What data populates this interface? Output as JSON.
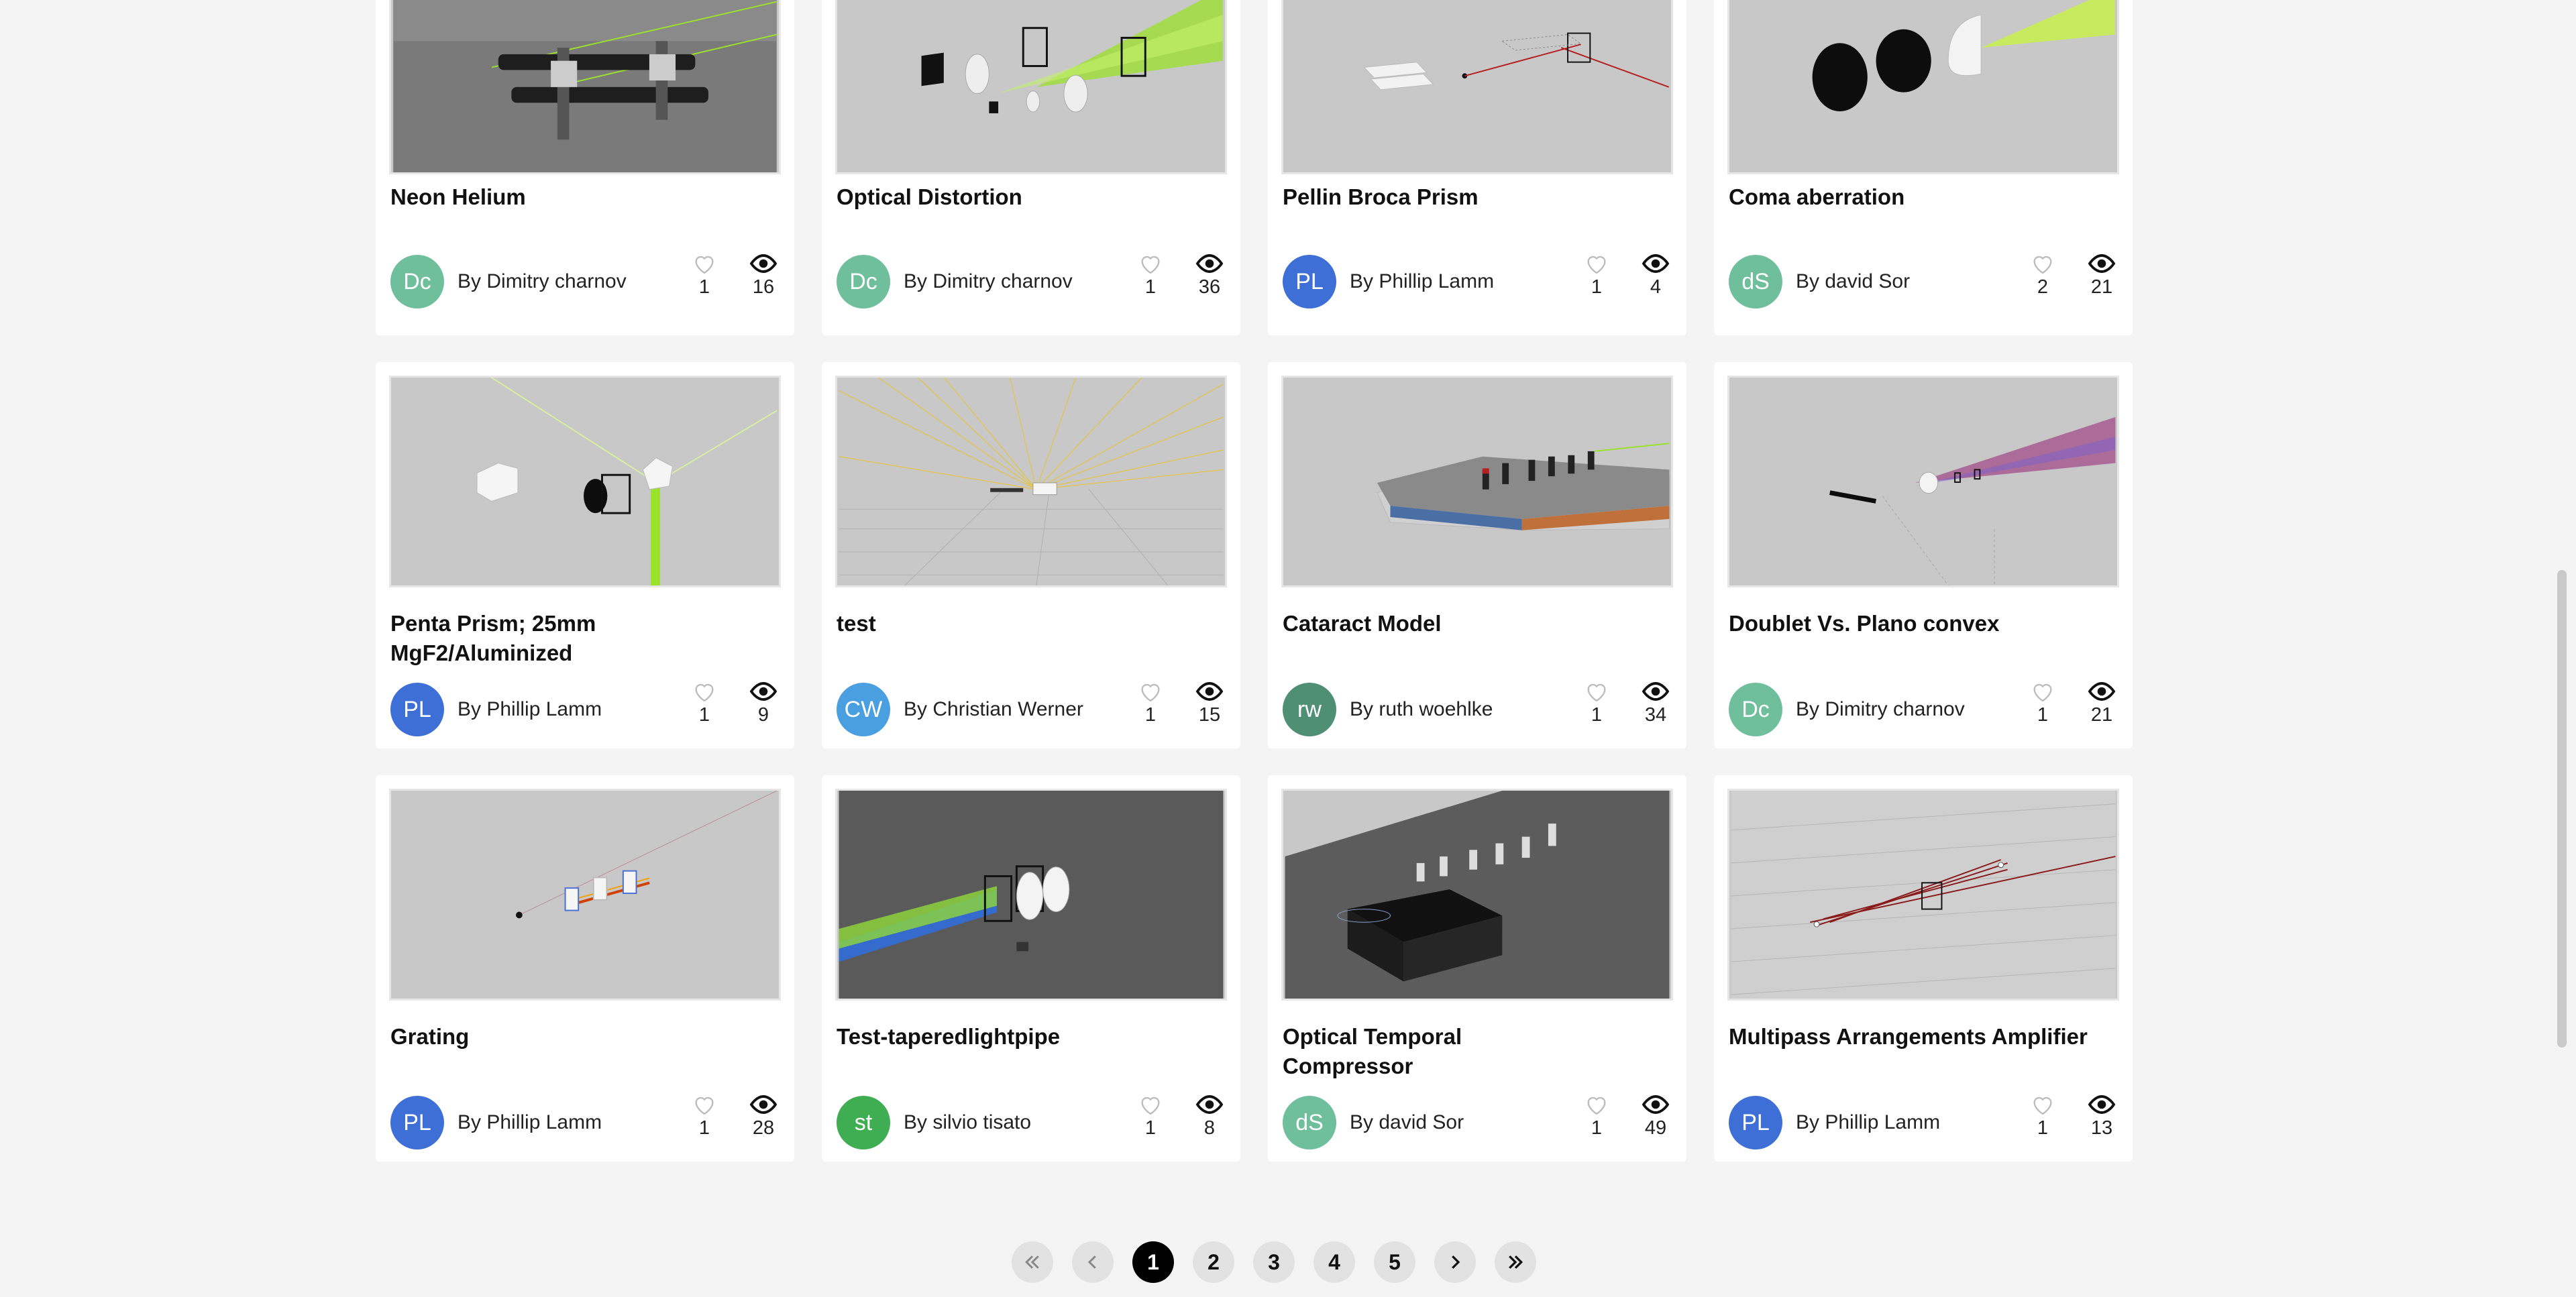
{
  "cards": [
    {
      "title": "Neon Helium",
      "author_prefix": "By",
      "author": "Dimitry charnov",
      "initials": "Dc",
      "avatar_color": "#6fbf9c",
      "likes": "1",
      "views": "16"
    },
    {
      "title": "Optical Distortion",
      "author_prefix": "By",
      "author": "Dimitry charnov",
      "initials": "Dc",
      "avatar_color": "#6fbf9c",
      "likes": "1",
      "views": "36"
    },
    {
      "title": "Pellin Broca Prism",
      "author_prefix": "By",
      "author": "Phillip Lamm",
      "initials": "PL",
      "avatar_color": "#3d6fd6",
      "likes": "1",
      "views": "4"
    },
    {
      "title": "Coma aberration",
      "author_prefix": "By",
      "author": "david Sor",
      "initials": "dS",
      "avatar_color": "#6fbf9c",
      "likes": "2",
      "views": "21"
    },
    {
      "title": "Penta Prism; 25mm MgF2/Aluminized",
      "author_prefix": "By",
      "author": "Phillip Lamm",
      "initials": "PL",
      "avatar_color": "#3d6fd6",
      "likes": "1",
      "views": "9"
    },
    {
      "title": "test",
      "author_prefix": "By",
      "author": "Christian Werner",
      "initials": "CW",
      "avatar_color": "#4a9fe0",
      "likes": "1",
      "views": "15"
    },
    {
      "title": "Cataract Model",
      "author_prefix": "By",
      "author": "ruth woehlke",
      "initials": "rw",
      "avatar_color": "#4f8f74",
      "likes": "1",
      "views": "34"
    },
    {
      "title": "Doublet Vs. Plano convex",
      "author_prefix": "By",
      "author": "Dimitry charnov",
      "initials": "Dc",
      "avatar_color": "#6fbf9c",
      "likes": "1",
      "views": "21"
    },
    {
      "title": "Grating",
      "author_prefix": "By",
      "author": "Phillip Lamm",
      "initials": "PL",
      "avatar_color": "#3d6fd6",
      "likes": "1",
      "views": "28"
    },
    {
      "title": "Test-taperedlightpipe",
      "author_prefix": "By",
      "author": "silvio tisato",
      "initials": "st",
      "avatar_color": "#3fae52",
      "likes": "1",
      "views": "8"
    },
    {
      "title": "Optical Temporal Compressor",
      "author_prefix": "By",
      "author": "david Sor",
      "initials": "dS",
      "avatar_color": "#6fbf9c",
      "likes": "1",
      "views": "49"
    },
    {
      "title": "Multipass Arrangements Amplifier",
      "author_prefix": "By",
      "author": "Phillip Lamm",
      "initials": "PL",
      "avatar_color": "#3d6fd6",
      "likes": "1",
      "views": "13"
    }
  ],
  "icons": {
    "like": "heart-outline-icon",
    "views": "eye-icon",
    "first": "double-chevron-left-icon",
    "prev": "chevron-left-icon",
    "next": "chevron-right-icon",
    "last": "double-chevron-right-icon"
  },
  "pagination": {
    "pages": [
      "1",
      "2",
      "3",
      "4",
      "5"
    ],
    "current": "1"
  },
  "colors": {
    "background": "#f4f4f4",
    "card": "#ffffff",
    "active_page": "#000000",
    "page_button": "#e2e2e2",
    "laser_green": "#9be22a",
    "laser_red": "#b52020",
    "laser_yellow": "#f5c400"
  }
}
